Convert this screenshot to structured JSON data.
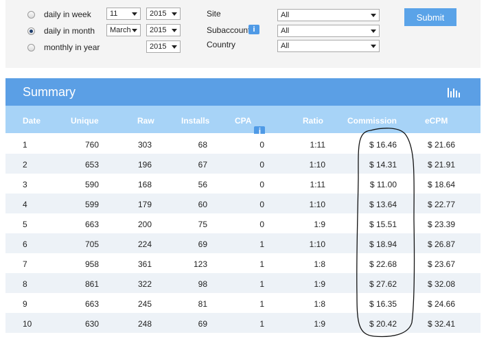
{
  "filters": {
    "radios": [
      {
        "label": "daily in week",
        "checked": false
      },
      {
        "label": "daily in month",
        "checked": true
      },
      {
        "label": "monthly in year",
        "checked": false
      }
    ],
    "week_select": "11",
    "week_year_select": "2015",
    "month_select": "March",
    "month_year_select": "2015",
    "year_select": "2015",
    "site_label": "Site",
    "site_value": "All",
    "subaccount_label": "Subaccount",
    "subaccount_value": "All",
    "country_label": "Country",
    "country_value": "All",
    "submit_label": "Submit"
  },
  "summary": {
    "title": "Summary",
    "columns": [
      "Date",
      "Unique",
      "Raw",
      "Installs",
      "CPA",
      "Ratio",
      "Commission",
      "eCPM"
    ],
    "rows": [
      {
        "date": "1",
        "unique": "760",
        "raw": "303",
        "installs": "68",
        "cpa": "0",
        "ratio": "1:11",
        "commission": "$ 16.46",
        "ecpm": "$ 21.66"
      },
      {
        "date": "2",
        "unique": "653",
        "raw": "196",
        "installs": "67",
        "cpa": "0",
        "ratio": "1:10",
        "commission": "$ 14.31",
        "ecpm": "$ 21.91"
      },
      {
        "date": "3",
        "unique": "590",
        "raw": "168",
        "installs": "56",
        "cpa": "0",
        "ratio": "1:11",
        "commission": "$ 11.00",
        "ecpm": "$ 18.64"
      },
      {
        "date": "4",
        "unique": "599",
        "raw": "179",
        "installs": "60",
        "cpa": "0",
        "ratio": "1:10",
        "commission": "$ 13.64",
        "ecpm": "$ 22.77"
      },
      {
        "date": "5",
        "unique": "663",
        "raw": "200",
        "installs": "75",
        "cpa": "0",
        "ratio": "1:9",
        "commission": "$ 15.51",
        "ecpm": "$ 23.39"
      },
      {
        "date": "6",
        "unique": "705",
        "raw": "224",
        "installs": "69",
        "cpa": "1",
        "ratio": "1:10",
        "commission": "$ 18.94",
        "ecpm": "$ 26.87"
      },
      {
        "date": "7",
        "unique": "958",
        "raw": "361",
        "installs": "123",
        "cpa": "1",
        "ratio": "1:8",
        "commission": "$ 22.68",
        "ecpm": "$ 23.67"
      },
      {
        "date": "8",
        "unique": "861",
        "raw": "322",
        "installs": "98",
        "cpa": "1",
        "ratio": "1:9",
        "commission": "$ 27.62",
        "ecpm": "$ 32.08"
      },
      {
        "date": "9",
        "unique": "663",
        "raw": "245",
        "installs": "81",
        "cpa": "1",
        "ratio": "1:8",
        "commission": "$ 16.35",
        "ecpm": "$ 24.66"
      },
      {
        "date": "10",
        "unique": "630",
        "raw": "248",
        "installs": "69",
        "cpa": "1",
        "ratio": "1:9",
        "commission": "$ 20.42",
        "ecpm": "$ 32.41"
      }
    ]
  },
  "icons": {
    "info": "i",
    "chart": "bar-chart-icon"
  },
  "colors": {
    "header_blue": "#5b9fe5",
    "subheader_blue": "#a7d3f7",
    "button_blue": "#5aa3e8",
    "row_alt": "#edf2f7"
  }
}
